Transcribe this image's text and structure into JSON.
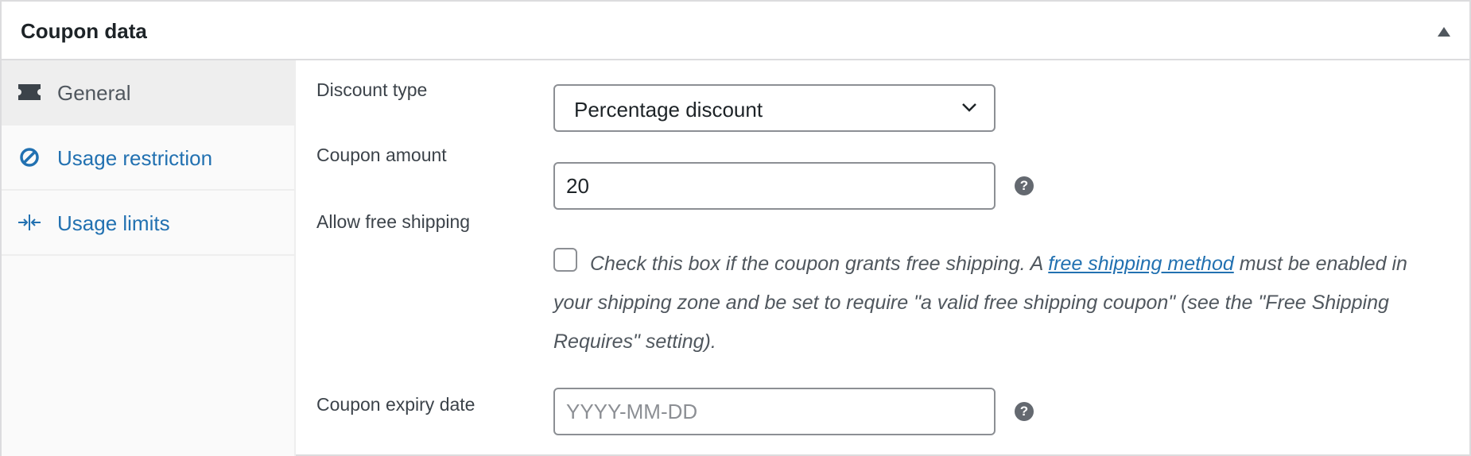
{
  "panel": {
    "title": "Coupon data"
  },
  "tabs": [
    {
      "label": "General",
      "icon": "ticket-icon",
      "active": true
    },
    {
      "label": "Usage restriction",
      "icon": "no-entry-icon",
      "active": false
    },
    {
      "label": "Usage limits",
      "icon": "limits-icon",
      "active": false
    }
  ],
  "fields": {
    "discount_type": {
      "label": "Discount type",
      "value": "Percentage discount"
    },
    "coupon_amount": {
      "label": "Coupon amount",
      "value": "20",
      "help": "?"
    },
    "free_shipping": {
      "label": "Allow free shipping",
      "checked": false,
      "text_before": "Check this box if the coupon grants free shipping. A ",
      "link_text": "free shipping method",
      "text_after": " must be enabled in your shipping zone and be set to require \"a valid free shipping coupon\" (see the \"Free Shipping Requires\" setting)."
    },
    "expiry_date": {
      "label": "Coupon expiry date",
      "placeholder": "YYYY-MM-DD",
      "help": "?"
    }
  },
  "colors": {
    "link": "#2271b1",
    "border": "#dcdcde",
    "active_tab": "#eeeeee",
    "sidebar": "#fafafa"
  }
}
